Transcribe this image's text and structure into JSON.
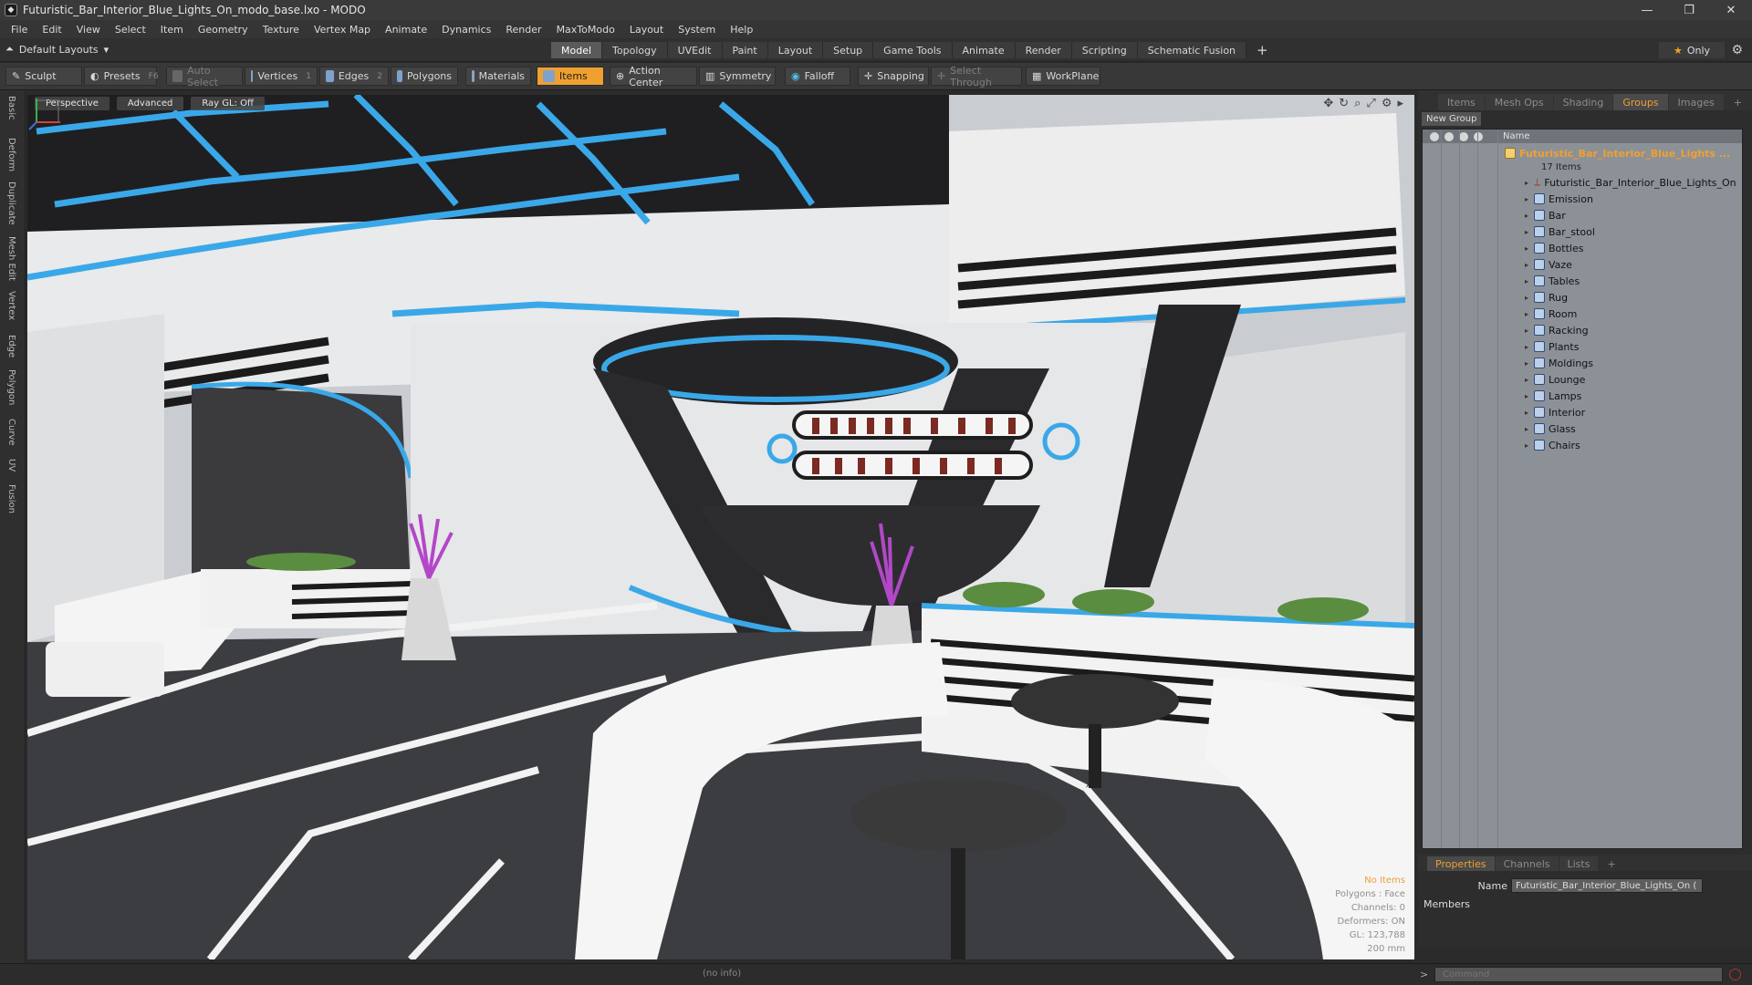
{
  "window": {
    "title": "Futuristic_Bar_Interior_Blue_Lights_On_modo_base.lxo - MODO"
  },
  "menu": [
    "File",
    "Edit",
    "View",
    "Select",
    "Item",
    "Geometry",
    "Texture",
    "Vertex Map",
    "Animate",
    "Dynamics",
    "Render",
    "MaxToModo",
    "Layout",
    "System",
    "Help"
  ],
  "layout": {
    "selector": "Default Layouts",
    "only_label": "Only"
  },
  "mode_tabs": [
    "Model",
    "Topology",
    "UVEdit",
    "Paint",
    "Layout",
    "Setup",
    "Game Tools",
    "Animate",
    "Render",
    "Scripting",
    "Schematic Fusion"
  ],
  "active_mode": "Model",
  "toolbar": {
    "sculpt": "Sculpt",
    "presets": "Presets",
    "presets_key": "F6",
    "auto_select": "Auto Select",
    "vertices": "Vertices",
    "vertices_key": "1",
    "edges": "Edges",
    "edges_key": "2",
    "polygons": "Polygons",
    "materials": "Materials",
    "items": "Items",
    "action_center": "Action Center",
    "symmetry": "Symmetry",
    "falloff": "Falloff",
    "snapping": "Snapping",
    "select_through": "Select Through",
    "workplane": "WorkPlane"
  },
  "left_tabs": [
    "Basic",
    "Deform",
    "Duplicate",
    "Mesh Edit",
    "Vertex",
    "Edge",
    "Polygon",
    "Curve",
    "UV",
    "Fusion"
  ],
  "viewport": {
    "mode": "Perspective",
    "shading": "Advanced",
    "raygl": "Ray GL: Off",
    "stats": {
      "items": "No Items",
      "polygons": "Polygons : Face",
      "channels": "Channels: 0",
      "deformers": "Deformers: ON",
      "gl": "GL: 123,788",
      "scale": "200 mm"
    }
  },
  "right_tabs": [
    "Items",
    "Mesh Ops",
    "Shading",
    "Groups",
    "Images"
  ],
  "active_right_tab": "Groups",
  "groups": {
    "new_group": "New Group",
    "name_header": "Name",
    "root": "Futuristic_Bar_Interior_Blue_Lights ...",
    "count": "17 Items",
    "children": [
      "Futuristic_Bar_Interior_Blue_Lights_On",
      "Emission",
      "Bar",
      "Bar_stool",
      "Bottles",
      "Vaze",
      "Tables",
      "Rug",
      "Room",
      "Racking",
      "Plants",
      "Moldings",
      "Lounge",
      "Lamps",
      "Interior",
      "Glass",
      "Chairs"
    ]
  },
  "properties": {
    "tabs": [
      "Properties",
      "Channels",
      "Lists"
    ],
    "name_label": "Name",
    "name_value": "Futuristic_Bar_Interior_Blue_Lights_On (",
    "members_label": "Members"
  },
  "status": {
    "info": "(no info)",
    "command_placeholder": "Command"
  },
  "colors": {
    "accent": "#f0a030",
    "neon": "#3aa8e8",
    "panel": "#2d2d2d"
  }
}
